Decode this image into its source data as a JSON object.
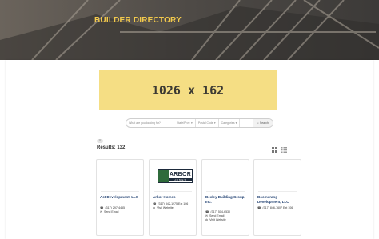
{
  "hero": {
    "title": "BUILDER DIRECTORY"
  },
  "ad": {
    "text": "1026 x 162"
  },
  "search": {
    "placeholder": "What are you looking for?",
    "state": "State/Prov.",
    "postal": "Postal Code",
    "categories": "Categories",
    "button": "Search"
  },
  "toggle": {
    "label": "☰"
  },
  "results": {
    "label": "Results: 132"
  },
  "cards": [
    {
      "name": "Act Development, LLC",
      "lines": [
        "(317) 297-4455",
        "Send Email"
      ]
    },
    {
      "name": "Arbor Homes",
      "lines": [
        "(317) 842-1975 Ext 106",
        "Visit Website"
      ],
      "logo": {
        "big": "ARBOR",
        "small": "HOMES"
      }
    },
    {
      "name": "Becley Building Group, Inc.",
      "lines": [
        "(317) 514-6530",
        "Send Email",
        "Visit Website"
      ]
    },
    {
      "name": "Boomerang Development, LLC",
      "lines": [
        "(317) 846-7607 Ext 106"
      ]
    }
  ],
  "colors": {
    "title": "#f2c94c",
    "ad_bg": "#f5de84",
    "card_name": "#1f3f70"
  }
}
